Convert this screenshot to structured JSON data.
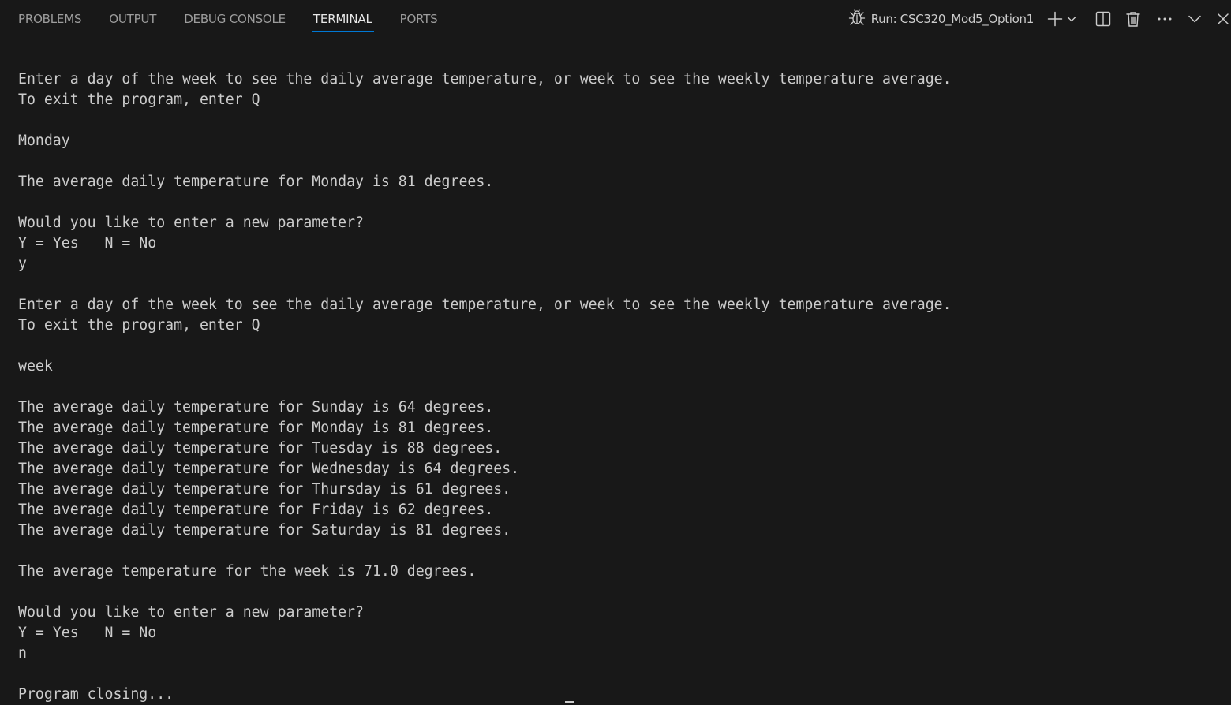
{
  "tabs": [
    {
      "label": "PROBLEMS",
      "active": false
    },
    {
      "label": "OUTPUT",
      "active": false
    },
    {
      "label": "DEBUG CONSOLE",
      "active": false
    },
    {
      "label": "TERMINAL",
      "active": true
    },
    {
      "label": "PORTS",
      "active": false
    }
  ],
  "run": {
    "label": "Run: CSC320_Mod5_Option1",
    "icon": "debug-icon"
  },
  "toolbar": {
    "new_terminal_icon": "plus-icon",
    "launch_profile_icon": "chevron-down-icon",
    "split_icon": "split-terminal-icon",
    "kill_icon": "trash-icon",
    "more_icon": "ellipsis-icon",
    "maximize_icon": "chevron-down-icon",
    "close_icon": "close-icon"
  },
  "colors": {
    "background": "#181818",
    "text": "#cccccc",
    "tab_inactive": "#9d9d9d",
    "tab_active": "#e7e7e7",
    "accent": "#0078d4"
  },
  "terminal": {
    "lines": [
      "Enter a day of the week to see the daily average temperature, or week to see the weekly temperature average.",
      "To exit the program, enter Q",
      "",
      "Monday",
      "",
      "The average daily temperature for Monday is 81 degrees.",
      "",
      "Would you like to enter a new parameter?",
      "Y = Yes   N = No",
      "y",
      "",
      "Enter a day of the week to see the daily average temperature, or week to see the weekly temperature average.",
      "To exit the program, enter Q",
      "",
      "week",
      "",
      "The average daily temperature for Sunday is 64 degrees.",
      "The average daily temperature for Monday is 81 degrees.",
      "The average daily temperature for Tuesday is 88 degrees.",
      "The average daily temperature for Wednesday is 64 degrees.",
      "The average daily temperature for Thursday is 61 degrees.",
      "The average daily temperature for Friday is 62 degrees.",
      "The average daily temperature for Saturday is 81 degrees.",
      "",
      "The average temperature for the week is 71.0 degrees.",
      "",
      "Would you like to enter a new parameter?",
      "Y = Yes   N = No",
      "n",
      "",
      "Program closing..."
    ]
  }
}
